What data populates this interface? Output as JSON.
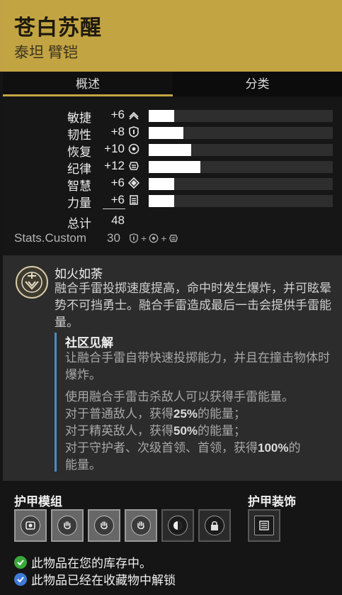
{
  "item": {
    "name": "苍白苏醒",
    "type": "泰坦 臂铠"
  },
  "tabs": [
    {
      "label": "概述"
    },
    {
      "label": "分类"
    }
  ],
  "stats": [
    {
      "name": "敏捷",
      "value": "+6",
      "icon": "mobility-icon",
      "fraction": 0.14
    },
    {
      "name": "韧性",
      "value": "+8",
      "icon": "resilience-icon",
      "fraction": 0.19
    },
    {
      "name": "恢复",
      "value": "+10",
      "icon": "recovery-icon",
      "fraction": 0.23
    },
    {
      "name": "纪律",
      "value": "+12",
      "icon": "discipline-icon",
      "fraction": 0.28
    },
    {
      "name": "智慧",
      "value": "+6",
      "icon": "intellect-icon",
      "fraction": 0.14
    },
    {
      "name": "力量",
      "value": "+6",
      "icon": "strength-icon",
      "fraction": 0.14
    }
  ],
  "total": {
    "label": "总计",
    "value": "48"
  },
  "custom": {
    "label": "Stats.Custom",
    "value": "30",
    "plus": "+"
  },
  "perk": {
    "name": "如火如荼",
    "description": "融合手雷投掷速度提高，命中时发生爆炸，并可眩晕势不可挡勇士。融合手雷造成最后一击会提供手雷能量。",
    "community": {
      "title": "社区见解",
      "p1": "让融合手雷自带快速投掷能力，并且在撞击物体时爆炸。",
      "p2_line1": "使用融合手雷击杀敌人可以获得手雷能量。",
      "p2_line2_a": "对于普通敌人，获得",
      "p2_line2_b": "25%",
      "p2_line2_c": "的能量；",
      "p2_line3_a": "对于精英敌人，获得",
      "p2_line3_b": "50%",
      "p2_line3_c": "的能量；",
      "p2_line4_a": "对于守护者、次级首领、首领，获得",
      "p2_line4_b": "100%",
      "p2_line4_c": "的",
      "p2_line5": "能量。"
    }
  },
  "mods": {
    "title": "护甲模组",
    "ornament_title": "护甲装饰",
    "slots": [
      "grenade-mod-icon",
      "hand-mod-icon",
      "hand-mod-icon",
      "hand-mod-icon",
      "artifice-mod-icon",
      "locked-mod-icon"
    ],
    "ornament": "ornament-icon"
  },
  "notes": [
    {
      "text": "此物品在您的库存中。",
      "icon": "check-green-icon",
      "color": "#3aa83a"
    },
    {
      "text": "此物品已经在收藏物中解锁",
      "icon": "check-blue-icon",
      "color": "#3f7bd8"
    }
  ]
}
